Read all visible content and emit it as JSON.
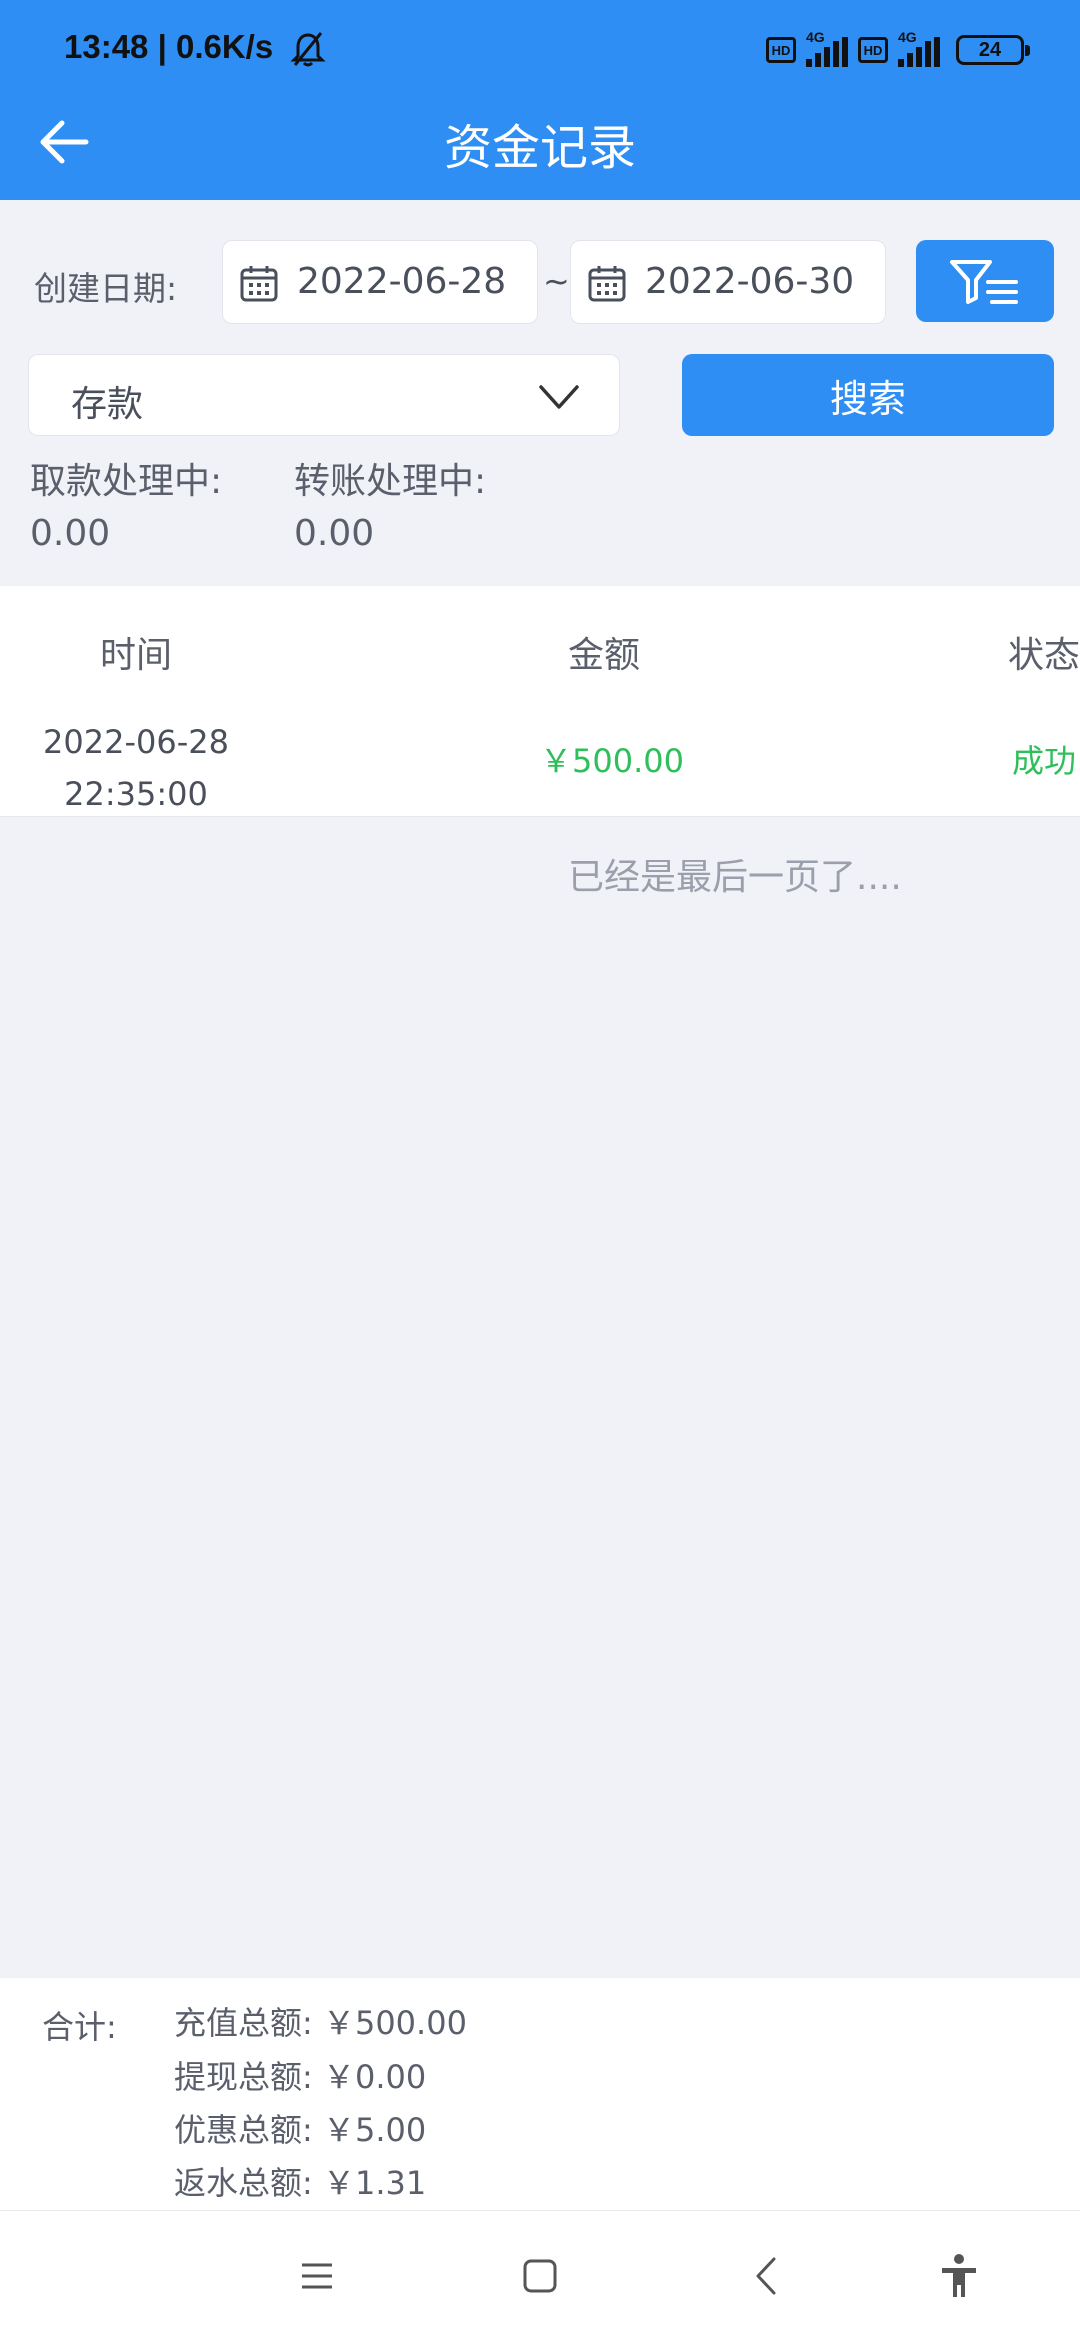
{
  "status_bar": {
    "time_speed": "13:48 | 0.6K/s",
    "hd_label": "HD",
    "network_label": "4G",
    "battery": "24"
  },
  "header": {
    "title": "资金记录"
  },
  "filters": {
    "date_label": "创建日期:",
    "start_date": "2022-06-28",
    "separator": "~",
    "end_date": "2022-06-30",
    "type_selected": "存款",
    "search_label": "搜索"
  },
  "pending": {
    "withdraw_label": "取款处理中:",
    "withdraw_value": "0.00",
    "transfer_label": "转账处理中:",
    "transfer_value": "0.00"
  },
  "table": {
    "columns": [
      "时间",
      "金额",
      "状态"
    ],
    "rows": [
      {
        "date": "2022-06-28",
        "time": "22:35:00",
        "amount": "￥500.00",
        "status": "成功"
      }
    ],
    "end_message": "已经是最后一页了...."
  },
  "summary": {
    "label": "合计:",
    "lines": [
      "充值总额: ￥500.00",
      "提现总额: ￥0.00",
      "优惠总额: ￥5.00",
      "返水总额: ￥1.31"
    ]
  },
  "colors": {
    "accent": "#2f8ef4",
    "success": "#2fbf5a",
    "background": "#f0f2f8"
  }
}
